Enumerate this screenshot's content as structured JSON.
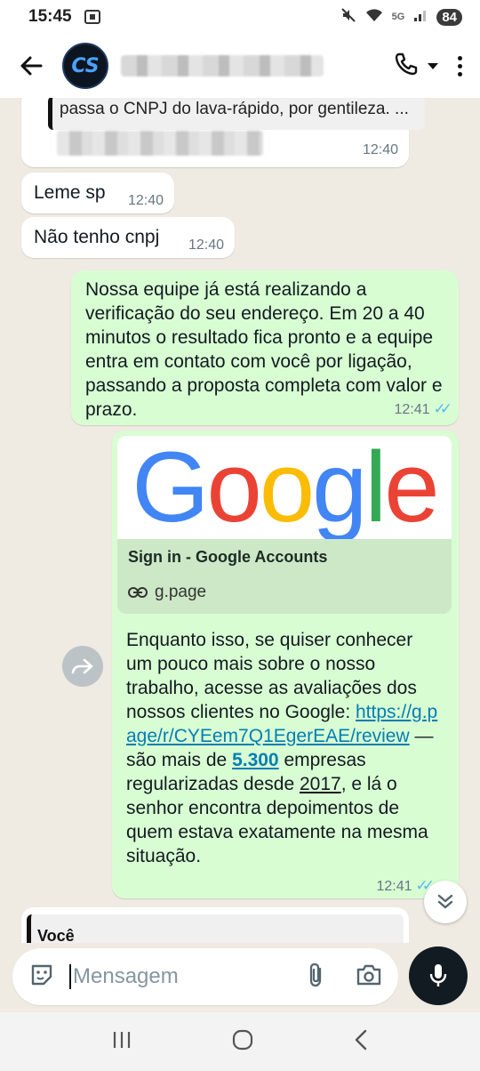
{
  "status": {
    "time": "15:45",
    "battery": "84",
    "network": "5G"
  },
  "header": {
    "back_icon": "arrow-left-icon",
    "avatar_text": "CS",
    "call_icon": "phone-icon",
    "menu_icon": "more-vert-icon"
  },
  "messages": {
    "quoted_text": "passa o CNPJ do lava-rápido, por gentileza. ...",
    "quoted_time": "12:40",
    "msg1_text": "Leme sp",
    "msg1_time": "12:40",
    "msg2_text": "Não tenho cnpj",
    "msg2_time": "12:40",
    "msg3_text": "Nossa equipe já está realizando a verificação do seu endereço. Em 20 a 40 minutos o resultado fica pronto e a equipe entra em contato com você por ligação, passando a proposta completa com valor e prazo.",
    "msg3_time": "12:41",
    "preview_logo": "Google",
    "preview_title": "Sign in - Google Accounts",
    "preview_domain": "g.page",
    "msg4_part1": "Enquanto isso, se quiser conhecer um pouco mais sobre o nosso trabalho, acesse as avaliações dos nossos clientes no Google: ",
    "msg4_link": "https://g.page/r/CYEem7Q1EgerEAE/review",
    "msg4_part2": " — são mais de ",
    "msg4_count": "5.300",
    "msg4_part3": " empresas regularizadas desde ",
    "msg4_year": "2017",
    "msg4_part4": ", e lá o senhor encontra depoimentos de quem estava exatamente na mesma situação.",
    "msg4_time": "12:41",
    "last_quote_name": "Você"
  },
  "composer": {
    "placeholder": "Mensagem"
  }
}
